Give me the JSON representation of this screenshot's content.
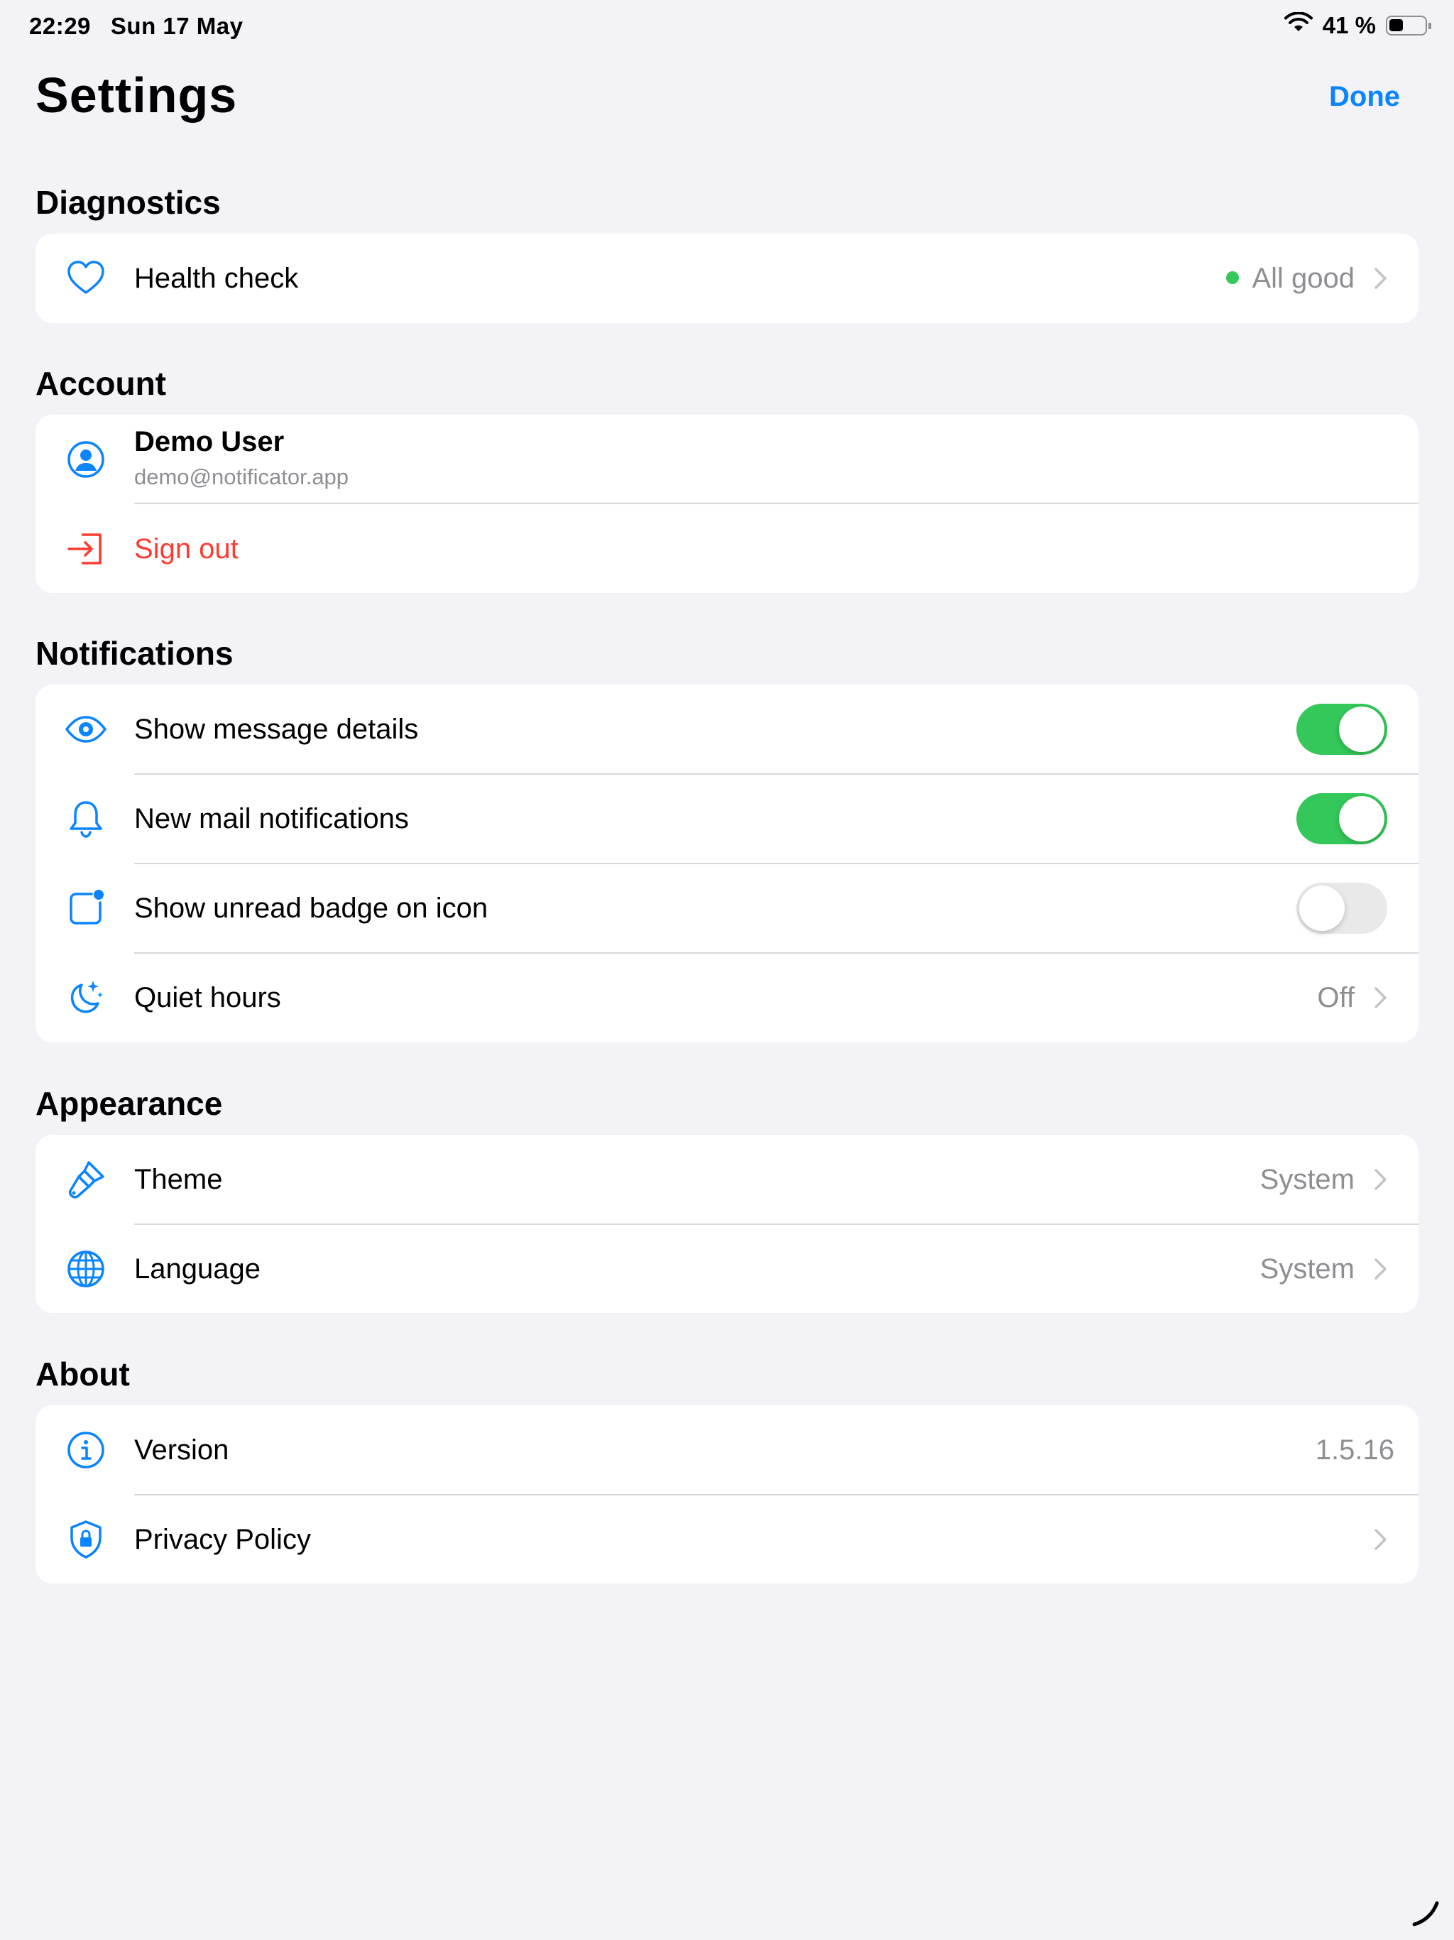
{
  "status_bar": {
    "time": "22:29",
    "date": "Sun 17 May",
    "battery_text": "41 %",
    "battery_level": 0.41
  },
  "header": {
    "title": "Settings",
    "done_label": "Done"
  },
  "colors": {
    "accent": "#0a84ff",
    "destructive": "#ff3b30",
    "toggle_on": "#34c759",
    "status_good": "#34c759",
    "secondary_text": "#8e8e93",
    "background": "#f2f2f7"
  },
  "sections": {
    "diagnostics": {
      "title": "Diagnostics",
      "health_check": {
        "label": "Health check",
        "value": "All good",
        "icon": "heart-icon"
      }
    },
    "account": {
      "title": "Account",
      "user": {
        "name": "Demo User",
        "email": "demo@notificator.app",
        "icon": "person-circle-icon"
      },
      "sign_out": {
        "label": "Sign out",
        "icon": "sign-out-icon"
      }
    },
    "notifications": {
      "title": "Notifications",
      "show_details": {
        "label": "Show message details",
        "enabled": true,
        "icon": "eye-icon"
      },
      "new_mail": {
        "label": "New mail notifications",
        "enabled": true,
        "icon": "bell-icon"
      },
      "unread_badge": {
        "label": "Show unread badge on icon",
        "enabled": false,
        "icon": "app-badge-icon"
      },
      "quiet_hours": {
        "label": "Quiet hours",
        "value": "Off",
        "icon": "moon-stars-icon"
      }
    },
    "appearance": {
      "title": "Appearance",
      "theme": {
        "label": "Theme",
        "value": "System",
        "icon": "paintbrush-icon"
      },
      "language": {
        "label": "Language",
        "value": "System",
        "icon": "globe-icon"
      }
    },
    "about": {
      "title": "About",
      "version": {
        "label": "Version",
        "value": "1.5.16",
        "icon": "info-circle-icon"
      },
      "privacy": {
        "label": "Privacy Policy",
        "icon": "shield-lock-icon"
      }
    }
  }
}
